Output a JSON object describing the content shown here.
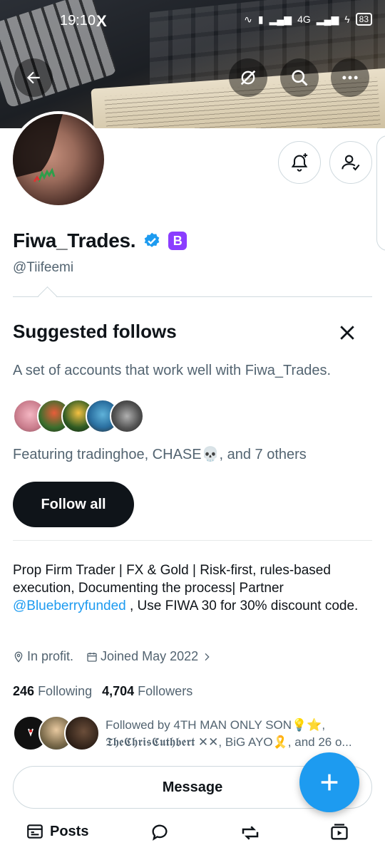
{
  "status_bar": {
    "time": "19:10",
    "x_logo": "X",
    "network": "4G",
    "battery": "83"
  },
  "header": {
    "icons": [
      "back-arrow-icon",
      "grok-icon",
      "search-icon",
      "more-icon"
    ]
  },
  "profile": {
    "display_name": "Fiwa_Trades.",
    "verified_badge": "verified-badge-icon",
    "extra_badge": "B",
    "handle": "@Tiifeemi",
    "action_icons": [
      "notification-plus-icon",
      "following-check-icon"
    ]
  },
  "suggested": {
    "title": "Suggested follows",
    "description": "A set of accounts that work well with Fiwa_Trades.",
    "featuring": "Featuring tradinghoe, CHASE💀, and 7 others",
    "follow_all_label": "Follow all"
  },
  "bio": {
    "text_before": "Prop Firm Trader | FX & Gold | Risk-first, rules-based execution, Documenting the process| Partner ",
    "mention": "@Blueberryfunded",
    "text_after": " , Use FIWA 30 for 30% discount code."
  },
  "meta": {
    "location": "In profit.",
    "joined": "Joined May 2022"
  },
  "counts": {
    "following_count": "246",
    "following_label": "Following",
    "followers_count": "4,704",
    "followers_label": "Followers"
  },
  "followed_by": {
    "text": "Followed by 4TH MAN ONLY SON💡⭐, 𝕿𝖍𝖊𝕮𝖍𝖗𝖎𝖘𝕮𝖚𝖙𝖍𝖇𝖊𝖗𝖙 ✕✕, BiG AYO🎗️, and 26 o..."
  },
  "actions": {
    "message_label": "Message"
  },
  "tabs": {
    "posts_label": "Posts"
  },
  "colors": {
    "accent": "#1d9bf0",
    "text_primary": "#0f1419",
    "text_secondary": "#536471",
    "badge_purple": "#8b3dff"
  }
}
